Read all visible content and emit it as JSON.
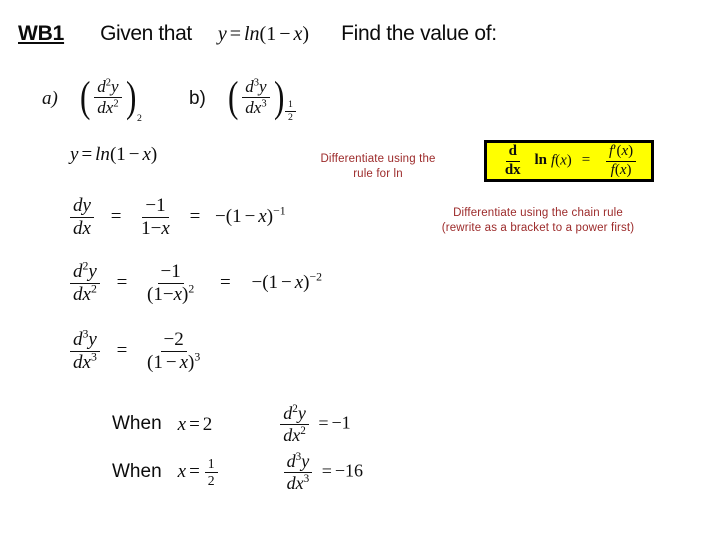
{
  "slide": {
    "background_color": "#ffffff",
    "accent_red": "#9c2a2a",
    "highlight_yellow": "#ffff00",
    "border_black": "#000000"
  },
  "header": {
    "wb_label": "WB1",
    "given_text": "Given that",
    "given_equation": {
      "lhs": "y",
      "equals": "=",
      "rhs_fn": "ln",
      "rhs_arg_open": "(",
      "rhs_one": "1",
      "rhs_minus": "−",
      "rhs_x": "x",
      "rhs_arg_close": ")"
    },
    "find_text": "Find the value of:"
  },
  "parts": [
    {
      "letter": "a)",
      "numerator": "d",
      "numerator_power": "2",
      "numerator_var": "y",
      "denominator": "dx",
      "denominator_power": "2",
      "evaluated_at": "2",
      "evaluated_at_is_fraction": false
    },
    {
      "letter": "b)",
      "numerator": "d",
      "numerator_power": "3",
      "numerator_var": "y",
      "denominator": "dx",
      "denominator_power": "3",
      "evaluated_at_numerator": "1",
      "evaluated_at_denominator": "2",
      "evaluated_at_is_fraction": true
    }
  ],
  "working": {
    "line_y": {
      "lhs": "y",
      "equals": "=",
      "fn": "ln",
      "open": "(",
      "one": "1",
      "minus": "−",
      "x": "x",
      "close": ")"
    },
    "line_first_derivative": {
      "lhs_num": "dy",
      "lhs_den": "dx",
      "equals_1": "=",
      "mid_num": "−1",
      "mid_den_one": "1",
      "mid_den_minus": "−",
      "mid_den_x": "x",
      "equals_2": "=",
      "rhs_sign": "−",
      "rhs_open": "(",
      "rhs_one": "1",
      "rhs_minus": "−",
      "rhs_x": "x",
      "rhs_close": ")",
      "rhs_power": "−1"
    },
    "line_second_derivative": {
      "lhs_num_d": "d",
      "lhs_num_pow": "2",
      "lhs_num_y": "y",
      "lhs_den_dx": "dx",
      "lhs_den_pow": "2",
      "equals_1": "=",
      "mid_num": "−1",
      "mid_den_open": "(",
      "mid_den_one": "1",
      "mid_den_minus": "−",
      "mid_den_x": "x",
      "mid_den_close": ")",
      "mid_den_pow": "2",
      "equals_2": "=",
      "rhs_sign": "−",
      "rhs_open": "(",
      "rhs_one": "1",
      "rhs_minus": "−",
      "rhs_x": "x",
      "rhs_close": ")",
      "rhs_power": "−2"
    },
    "line_third_derivative": {
      "lhs_num_d": "d",
      "lhs_num_pow": "3",
      "lhs_num_y": "y",
      "lhs_den_dx": "dx",
      "lhs_den_pow": "3",
      "equals_1": "=",
      "mid_num": "−2",
      "mid_den_open": "(",
      "mid_den_one": "1",
      "mid_den_minus": "−",
      "mid_den_x": "x",
      "mid_den_close": ")",
      "mid_den_pow": "3"
    }
  },
  "when_rows": [
    {
      "word": "When",
      "var": "x",
      "equals": "=",
      "value": "2",
      "value_is_fraction": false,
      "result_num_d": "d",
      "result_num_pow": "2",
      "result_num_y": "y",
      "result_den_dx": "dx",
      "result_den_pow": "2",
      "result_equals": "=",
      "result_value": "−1"
    },
    {
      "word": "When",
      "var": "x",
      "equals": "=",
      "value_numerator": "1",
      "value_denominator": "2",
      "value_is_fraction": true,
      "result_num_d": "d",
      "result_num_pow": "3",
      "result_num_y": "y",
      "result_den_dx": "dx",
      "result_den_pow": "3",
      "result_equals": "=",
      "result_value": "−16"
    }
  ],
  "annotations": [
    {
      "id": "ln-rule-note",
      "line_1": "Differentiate using the",
      "line_2": "rule for ln"
    },
    {
      "id": "chain-rule-note",
      "line_1": "Differentiate using the chain rule",
      "line_2": "(rewrite as a bracket to a power first)"
    }
  ],
  "rule_box": {
    "d_top": "d",
    "d_bottom": "dx",
    "ln_word": "ln",
    "f": "f",
    "open": "(",
    "x": "x",
    "close": ")",
    "equals": "=",
    "rhs_num_f": "f",
    "rhs_num_prime": "′",
    "rhs_num_open": "(",
    "rhs_num_x": "x",
    "rhs_num_close": ")",
    "rhs_den_f": "f",
    "rhs_den_open": "(",
    "rhs_den_x": "x",
    "rhs_den_close": ")"
  }
}
